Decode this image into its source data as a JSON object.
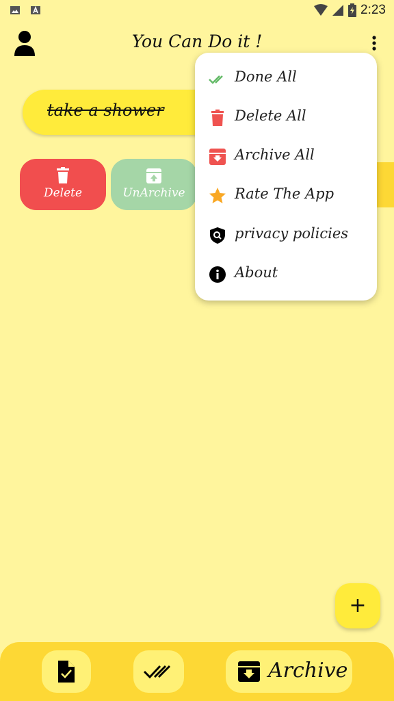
{
  "status": {
    "time": "2:23"
  },
  "app": {
    "title": "You Can Do it !"
  },
  "tasks": [
    {
      "label": "take a shower",
      "done": true
    }
  ],
  "swipe_actions": {
    "delete_label": "Delete",
    "unarchive_label": "UnArchive"
  },
  "menu": {
    "items": [
      {
        "label": "Done All",
        "icon": "double-check-icon"
      },
      {
        "label": "Delete All",
        "icon": "trash-icon"
      },
      {
        "label": "Archive All",
        "icon": "archive-icon"
      },
      {
        "label": "Rate The App",
        "icon": "star-icon"
      },
      {
        "label": "privacy policies",
        "icon": "shield-search-icon"
      },
      {
        "label": "About",
        "icon": "info-icon"
      }
    ]
  },
  "fab": {
    "label": "+"
  },
  "bottom_nav": {
    "archive_label": "Archive"
  },
  "colors": {
    "background": "#fff59d",
    "accent_yellow": "#ffeb3b",
    "delete_red": "#f14e4e",
    "unarchive_green": "#a5d6a7",
    "done_green": "#66bb6a",
    "star_orange": "#f9a825"
  }
}
